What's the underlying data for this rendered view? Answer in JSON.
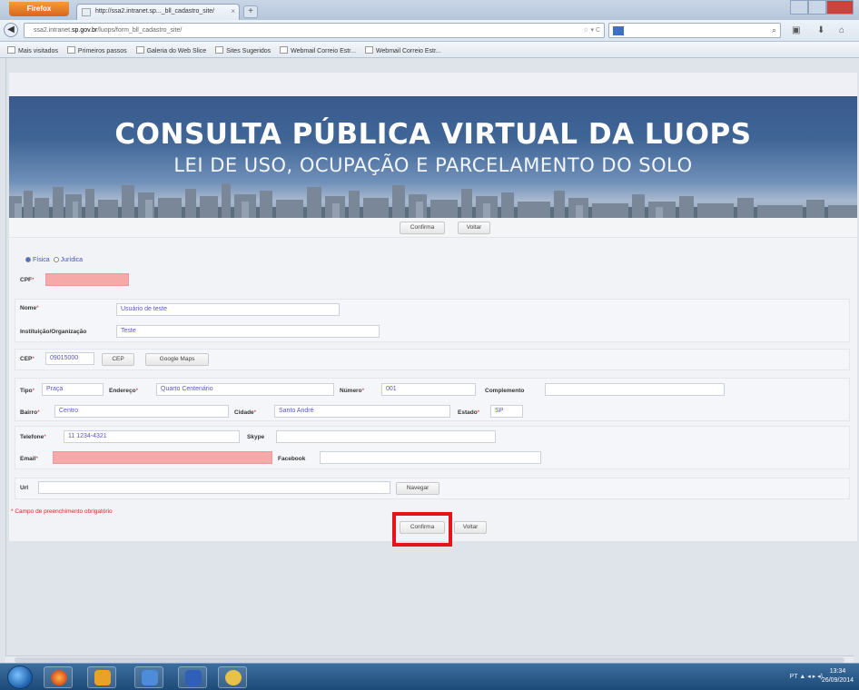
{
  "browser": {
    "menu_label": "Firefox",
    "tab_title": "http://ssa2.intranet.sp..._bll_cadastro_site/",
    "new_tab": "+",
    "url_prefix": "ssa2.intranet.",
    "url_domain": "sp.gov.br",
    "url_suffix": "/luops/form_bll_cadastro_site/",
    "url_controls": "☆ ▾ C",
    "bookmarks": [
      "Mais visitados",
      "Primeiros passos",
      "Galeria do Web Slice",
      "Sites Sugeridos",
      "Webmail Correio Estr...",
      "Webmail Correio Estr..."
    ]
  },
  "banner": {
    "title": "CONSULTA PÚBLICA VIRTUAL DA LUOPS",
    "subtitle": "LEI DE USO, OCUPAÇÃO E PARCELAMENTO DO SOLO"
  },
  "toolbar": {
    "confirm": "Confirma",
    "back": "Voltar"
  },
  "form": {
    "person_type": {
      "options": [
        "Física",
        "Jurídica"
      ],
      "selected": "Física"
    },
    "cpf": {
      "label": "CPF",
      "value": ""
    },
    "name": {
      "label": "Nome",
      "value": "Usuário de teste"
    },
    "institution": {
      "label": "Instituição/Organização",
      "value": "Teste"
    },
    "cep": {
      "label": "CEP",
      "value": "09015000",
      "button": "CEP",
      "maps_button": "Google Maps"
    },
    "type": {
      "label": "Tipo",
      "value": "Praça"
    },
    "address": {
      "label": "Endereço",
      "value": "Quarto Centenário"
    },
    "number": {
      "label": "Número",
      "value": "001"
    },
    "complement": {
      "label": "Complemento",
      "value": ""
    },
    "district": {
      "label": "Bairro",
      "value": "Centro"
    },
    "city": {
      "label": "Cidade",
      "value": "Santo André"
    },
    "state": {
      "label": "Estado",
      "value": "SP"
    },
    "phone": {
      "label": "Telefone",
      "value": "11 1234-4321"
    },
    "skype": {
      "label": "Skype",
      "value": ""
    },
    "email": {
      "label": "Email",
      "value": ""
    },
    "facebook": {
      "label": "Facebook",
      "value": ""
    },
    "url": {
      "label": "Url",
      "value": "",
      "button": "Navegar"
    },
    "required_note": "* Campo de preenchimento obrigatório",
    "required_mark": "*"
  },
  "bottom_toolbar": {
    "confirm": "Confirma",
    "back": "Voltar"
  },
  "taskbar": {
    "tray": "PT ▲ ◂ ▸ ◂)",
    "time": "13:34",
    "date": "26/09/2014"
  }
}
